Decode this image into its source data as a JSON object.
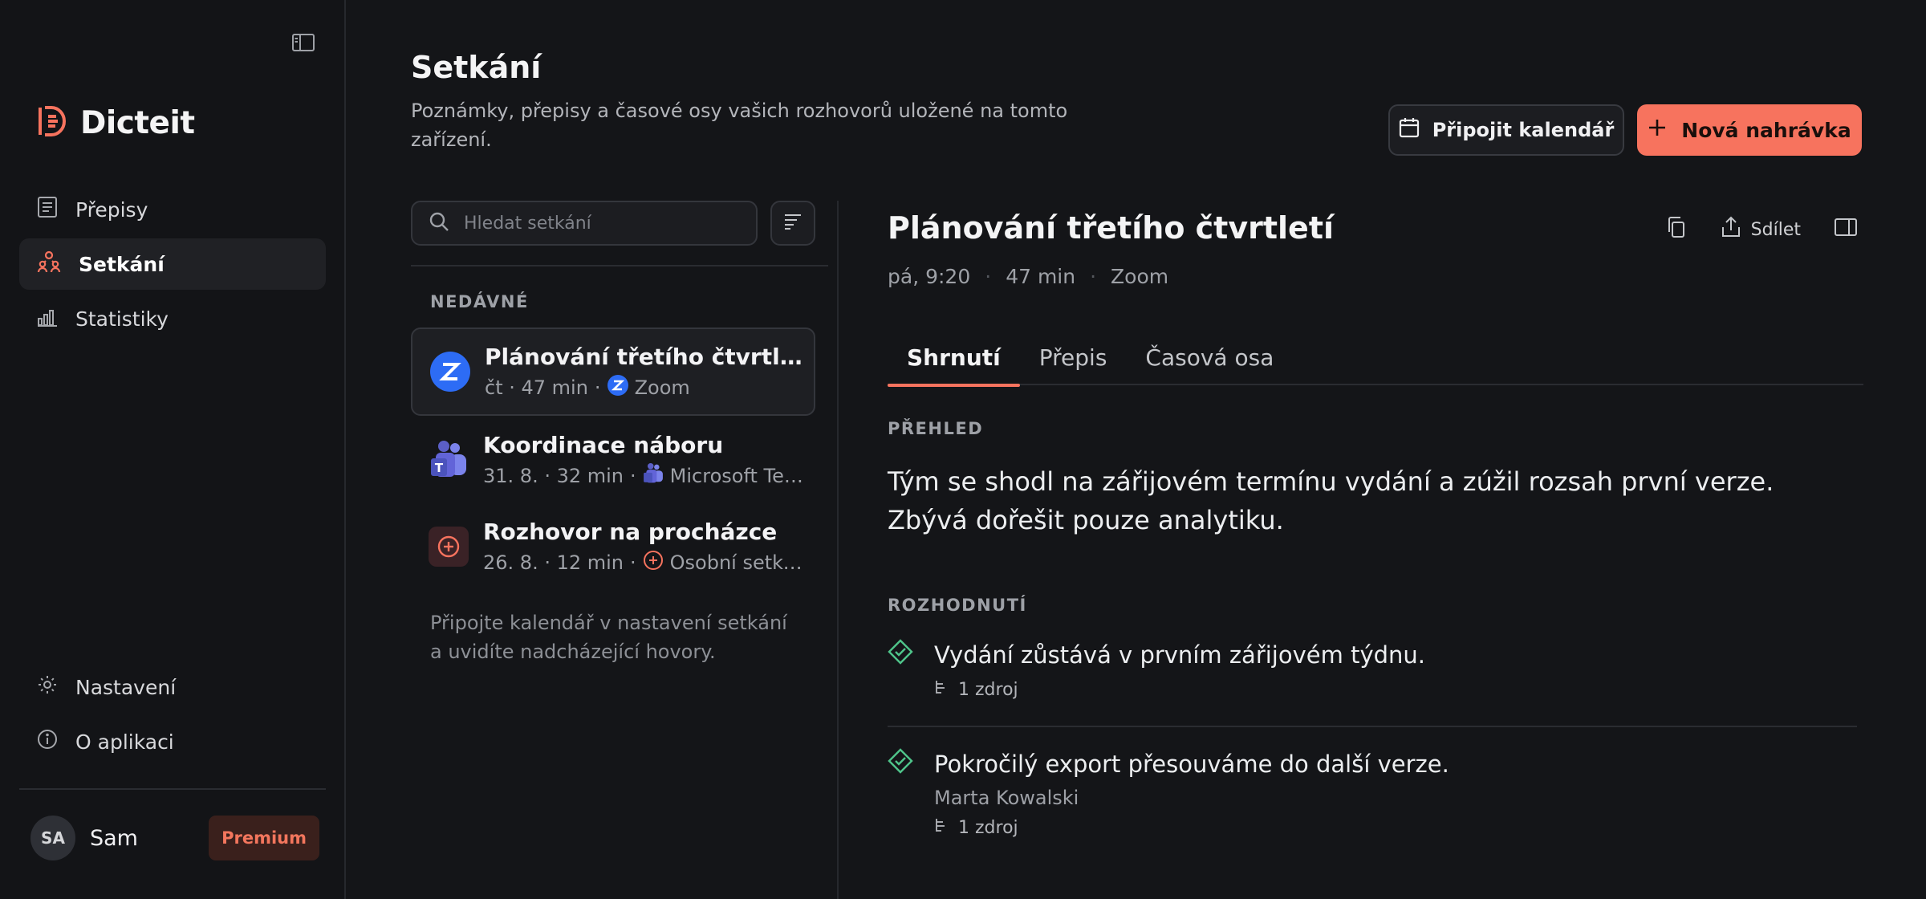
{
  "app": {
    "name": "Dicteit",
    "accent": "#f7735e"
  },
  "sidebar": {
    "items": [
      {
        "label": "Přepisy",
        "icon": "document-icon",
        "active": false
      },
      {
        "label": "Setkání",
        "icon": "people-icon",
        "active": true
      },
      {
        "label": "Statistiky",
        "icon": "bar-chart-icon",
        "active": false
      }
    ],
    "bottom_items": [
      {
        "label": "Nastavení",
        "icon": "gear-icon"
      },
      {
        "label": "O aplikaci",
        "icon": "info-icon"
      }
    ],
    "user": {
      "initials": "SA",
      "name": "Sam",
      "plan_badge": "Premium"
    }
  },
  "header": {
    "title": "Setkání",
    "subtitle": "Poznámky, přepisy a časové osy vašich rozhovorů uložené na tomto zařízení.",
    "connect_calendar_label": "Připojit kalendář",
    "new_recording_label": "Nová nahrávka"
  },
  "meeting_list": {
    "search_placeholder": "Hledat setkání",
    "recent_label": "NEDÁVNÉ",
    "items": [
      {
        "title": "Plánování třetího čtvrtletí",
        "meta": "čt · 47 min",
        "source": "Zoom",
        "source_icon": "zoom-icon",
        "active": true
      },
      {
        "title": "Koordinace náboru",
        "meta": "31. 8. · 32 min",
        "source": "Microsoft Teams",
        "source_icon": "teams-icon",
        "active": false
      },
      {
        "title": "Rozhovor na procházce",
        "meta": "26. 8. · 12 min",
        "source": "Osobní setkání",
        "source_icon": "in-person-icon",
        "active": false
      }
    ],
    "separator": "·",
    "calendar_hint": "Připojte kalendář v nastavení setkání a uvidíte nadcházející hovory."
  },
  "detail": {
    "title": "Plánování třetího čtvrtletí",
    "meta": [
      "pá, 9:20",
      "47 min",
      "Zoom"
    ],
    "meta_separator": "·",
    "share_label": "Sdílet",
    "tabs": [
      {
        "label": "Shrnutí",
        "active": true
      },
      {
        "label": "Přepis",
        "active": false
      },
      {
        "label": "Časová osa",
        "active": false
      }
    ],
    "overview_label": "PŘEHLED",
    "overview_text": "Tým se shodl na zářijovém termínu vydání a zúžil rozsah první verze. Zbývá dořešit pouze analytiku.",
    "decisions_label": "ROZHODNUTÍ",
    "decisions": [
      {
        "text": "Vydání zůstává v prvním zářijovém týdnu.",
        "owner": "",
        "sources": "1 zdroj"
      },
      {
        "text": "Pokročilý export přesouváme do další verze.",
        "owner": "Marta Kowalski",
        "sources": "1 zdroj"
      }
    ]
  }
}
